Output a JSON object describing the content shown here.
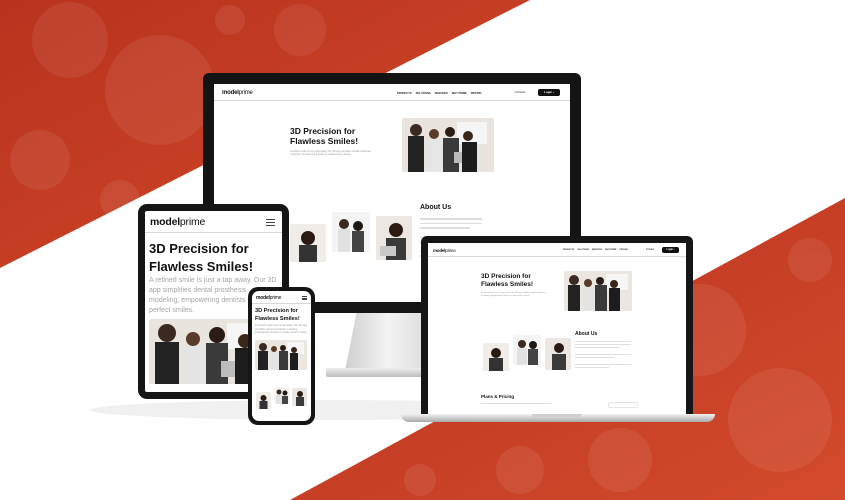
{
  "brand": {
    "name_bold": "model",
    "name_light": "prime"
  },
  "nav_items": [
    "PRODUCTS",
    "SOLUTIONS",
    "SERVICES",
    "WHY PRIME",
    "PRICING"
  ],
  "header_buttons": {
    "contact": "Contact",
    "login": "Login"
  },
  "hero": {
    "title_line1": "3D Precision for",
    "title_line2": "Flawless Smiles!",
    "subtitle": "A refined smile is just a tap away. Our 3D app simplifies dental prosthesis modeling, empowering dentists to create perfect smiles."
  },
  "about": {
    "title": "About Us"
  },
  "pricing": {
    "title": "Plans & Pricing"
  },
  "colors": {
    "accent": "#c73a22",
    "dark": "#111111"
  }
}
